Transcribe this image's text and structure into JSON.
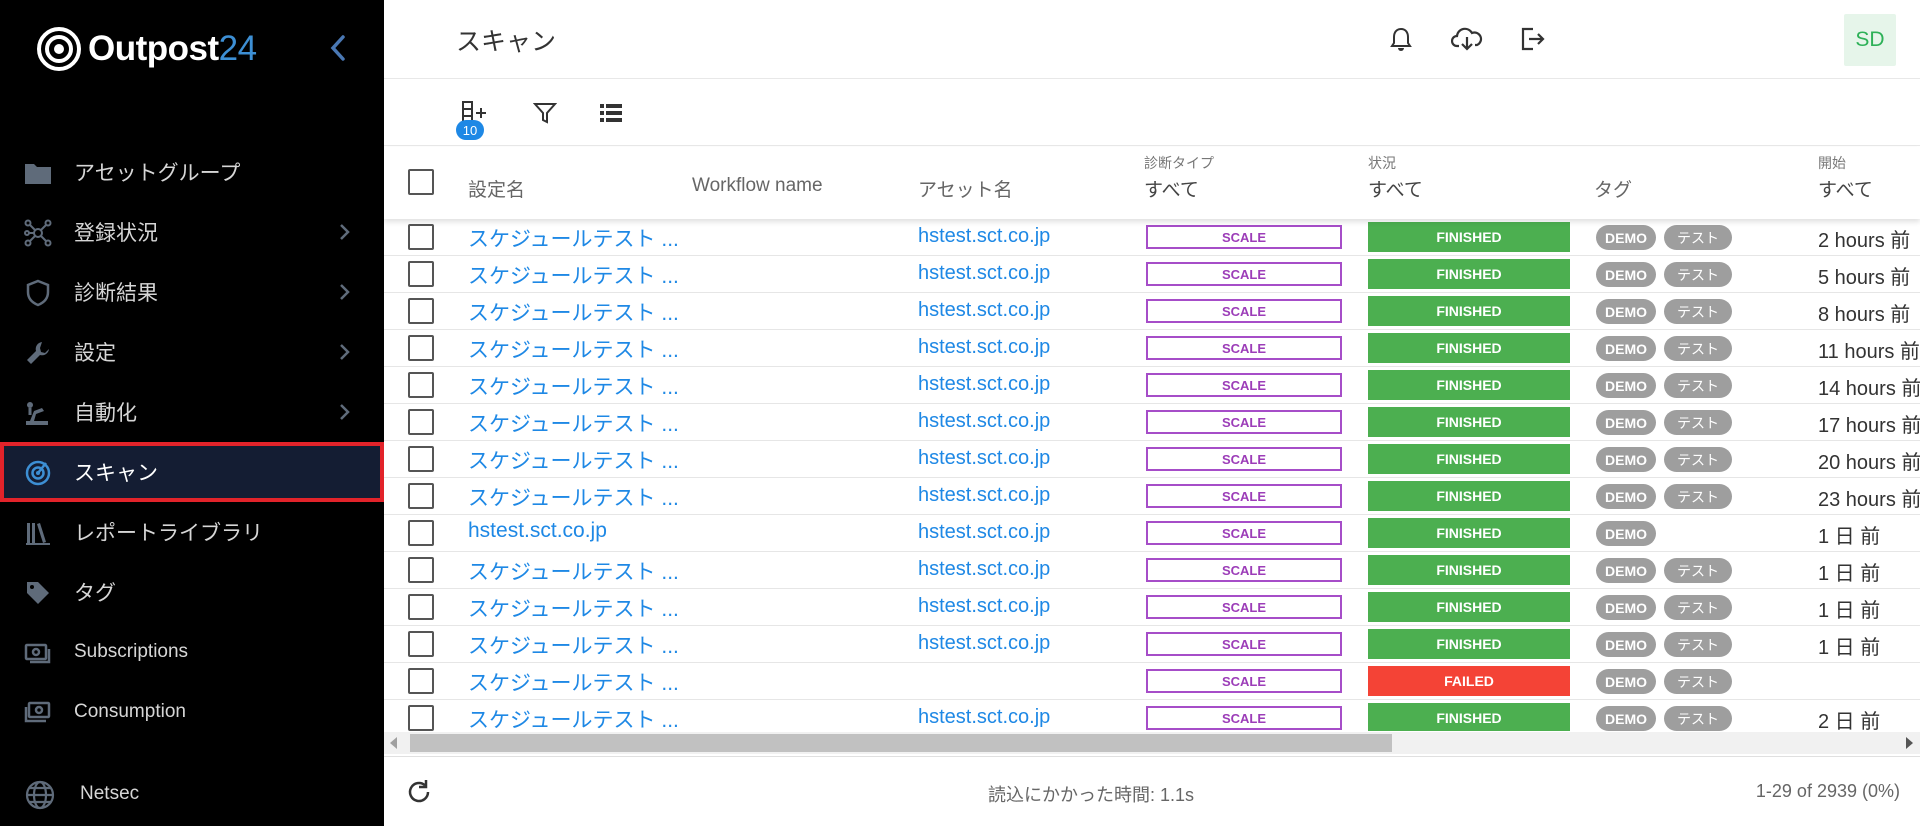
{
  "brand": {
    "name": "Outpost",
    "number": "24"
  },
  "sidebar": {
    "items": [
      {
        "label": "アセットグループ",
        "icon": "folder-icon",
        "has_chevron": false
      },
      {
        "label": "登録状況",
        "icon": "network-icon",
        "has_chevron": true
      },
      {
        "label": "診断結果",
        "icon": "shield-icon",
        "has_chevron": true
      },
      {
        "label": "設定",
        "icon": "wrench-icon",
        "has_chevron": true
      },
      {
        "label": "自動化",
        "icon": "automation-icon",
        "has_chevron": true
      },
      {
        "label": "スキャン",
        "icon": "radar-icon",
        "has_chevron": false,
        "active": true
      },
      {
        "label": "レポートライブラリ",
        "icon": "library-icon",
        "has_chevron": false
      },
      {
        "label": "タグ",
        "icon": "tag-icon",
        "has_chevron": false
      },
      {
        "label": "Subscriptions",
        "icon": "subscriptions-icon",
        "has_chevron": false
      },
      {
        "label": "Consumption",
        "icon": "consumption-icon",
        "has_chevron": false
      }
    ],
    "bottom": {
      "label": "Netsec",
      "icon": "globe-icon"
    }
  },
  "header": {
    "title": "スキャン",
    "avatar": "SD"
  },
  "toolbar": {
    "badge": "10"
  },
  "columns": {
    "name": "設定名",
    "workflow": "Workflow name",
    "asset": "アセット名",
    "type_label": "診断タイプ",
    "type_value": "すべて",
    "status_label": "状況",
    "status_value": "すべて",
    "tags": "タグ",
    "start_label": "開始",
    "start_value": "すべて"
  },
  "rows": [
    {
      "name": "スケジュールテスト ...",
      "asset": "hstest.sct.co.jp",
      "type": "SCALE",
      "status": "FINISHED",
      "tags": [
        "DEMO",
        "テスト"
      ],
      "start": "2 hours 前"
    },
    {
      "name": "スケジュールテスト ...",
      "asset": "hstest.sct.co.jp",
      "type": "SCALE",
      "status": "FINISHED",
      "tags": [
        "DEMO",
        "テスト"
      ],
      "start": "5 hours 前"
    },
    {
      "name": "スケジュールテスト ...",
      "asset": "hstest.sct.co.jp",
      "type": "SCALE",
      "status": "FINISHED",
      "tags": [
        "DEMO",
        "テスト"
      ],
      "start": "8 hours 前"
    },
    {
      "name": "スケジュールテスト ...",
      "asset": "hstest.sct.co.jp",
      "type": "SCALE",
      "status": "FINISHED",
      "tags": [
        "DEMO",
        "テスト"
      ],
      "start": "11 hours 前"
    },
    {
      "name": "スケジュールテスト ...",
      "asset": "hstest.sct.co.jp",
      "type": "SCALE",
      "status": "FINISHED",
      "tags": [
        "DEMO",
        "テスト"
      ],
      "start": "14 hours 前"
    },
    {
      "name": "スケジュールテスト ...",
      "asset": "hstest.sct.co.jp",
      "type": "SCALE",
      "status": "FINISHED",
      "tags": [
        "DEMO",
        "テスト"
      ],
      "start": "17 hours 前"
    },
    {
      "name": "スケジュールテスト ...",
      "asset": "hstest.sct.co.jp",
      "type": "SCALE",
      "status": "FINISHED",
      "tags": [
        "DEMO",
        "テスト"
      ],
      "start": "20 hours 前"
    },
    {
      "name": "スケジュールテスト ...",
      "asset": "hstest.sct.co.jp",
      "type": "SCALE",
      "status": "FINISHED",
      "tags": [
        "DEMO",
        "テスト"
      ],
      "start": "23 hours 前"
    },
    {
      "name": "hstest.sct.co.jp",
      "asset": "hstest.sct.co.jp",
      "type": "SCALE",
      "status": "FINISHED",
      "tags": [
        "DEMO"
      ],
      "start": "1 日 前"
    },
    {
      "name": "スケジュールテスト ...",
      "asset": "hstest.sct.co.jp",
      "type": "SCALE",
      "status": "FINISHED",
      "tags": [
        "DEMO",
        "テスト"
      ],
      "start": "1 日 前"
    },
    {
      "name": "スケジュールテスト ...",
      "asset": "hstest.sct.co.jp",
      "type": "SCALE",
      "status": "FINISHED",
      "tags": [
        "DEMO",
        "テスト"
      ],
      "start": "1 日 前"
    },
    {
      "name": "スケジュールテスト ...",
      "asset": "hstest.sct.co.jp",
      "type": "SCALE",
      "status": "FINISHED",
      "tags": [
        "DEMO",
        "テスト"
      ],
      "start": "1 日 前"
    },
    {
      "name": "スケジュールテスト ...",
      "asset": "",
      "type": "SCALE",
      "status": "FAILED",
      "tags": [
        "DEMO",
        "テスト"
      ],
      "start": ""
    },
    {
      "name": "スケジュールテスト ...",
      "asset": "hstest.sct.co.jp",
      "type": "SCALE",
      "status": "FINISHED",
      "tags": [
        "DEMO",
        "テスト"
      ],
      "start": "2 日 前"
    }
  ],
  "footer": {
    "load_time": "読込にかかった時間: 1.1s",
    "pagination": "1-29 of 2939 (0%)"
  },
  "colors": {
    "sidebar_bg": "#000000",
    "active_item_border": "#e2232a",
    "link": "#1e88e5",
    "finished": "#4caf50",
    "failed": "#f44336",
    "scale_border": "#a64dc8"
  }
}
